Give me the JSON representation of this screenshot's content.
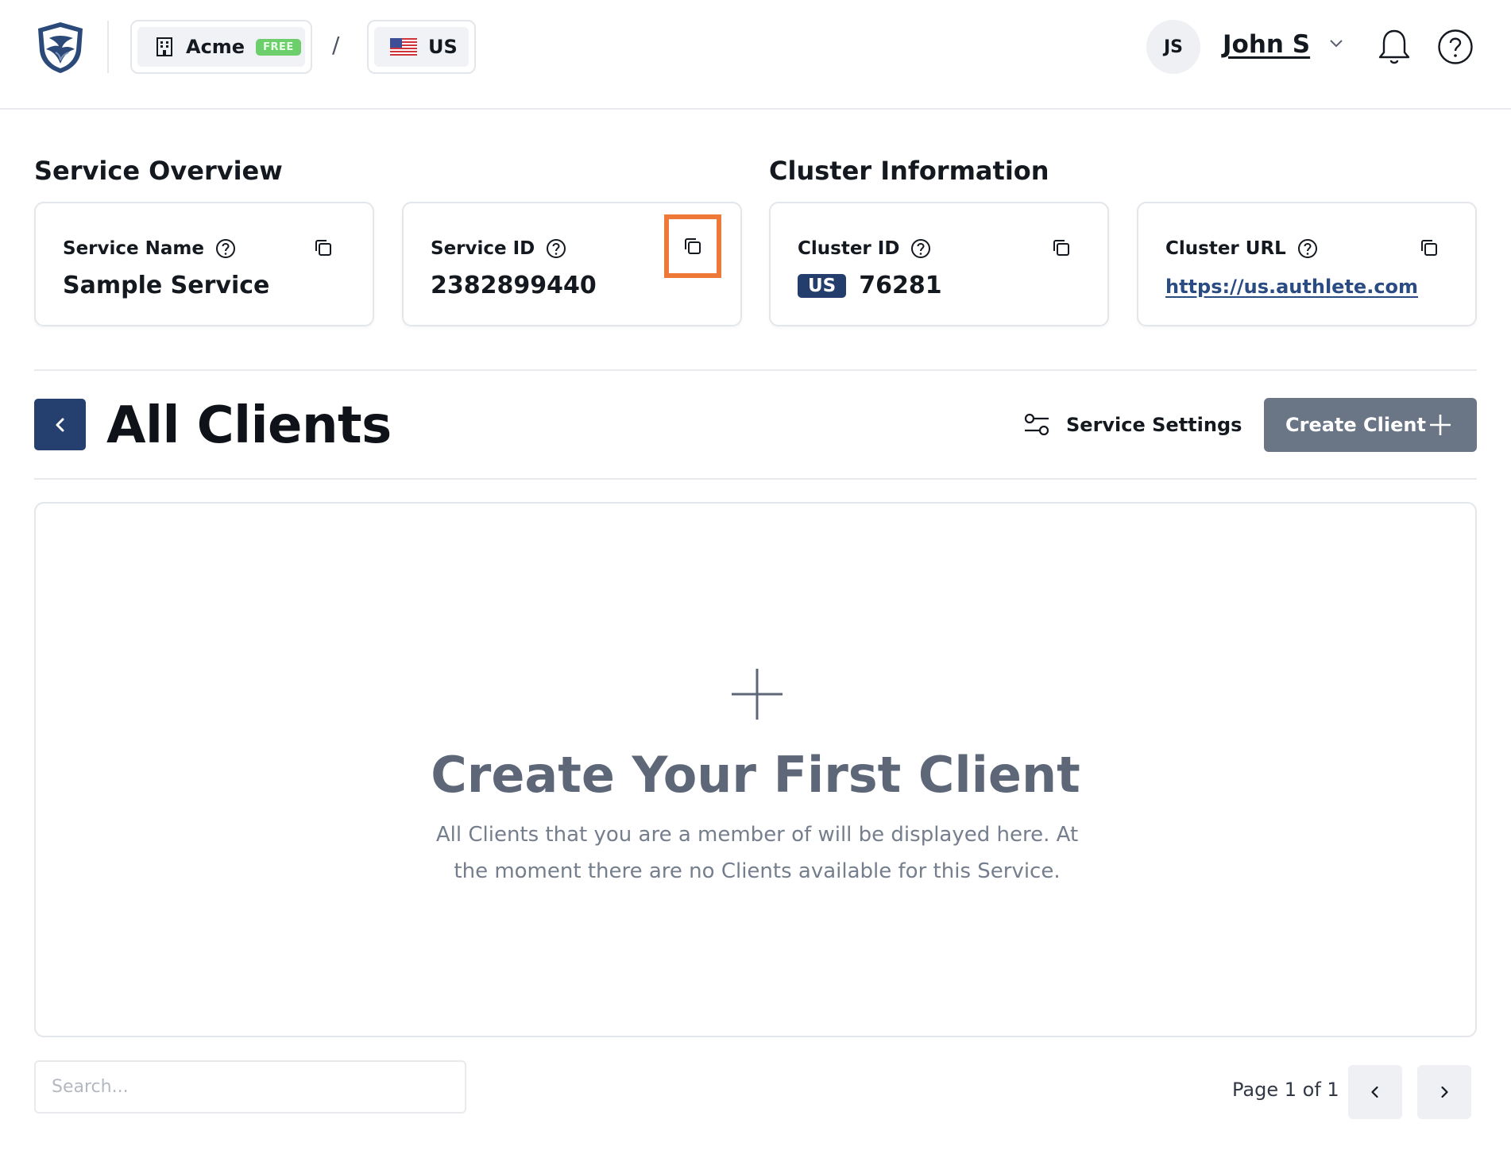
{
  "header": {
    "org": {
      "name": "Acme",
      "plan_badge": "FREE"
    },
    "separator": "/",
    "region": {
      "code": "US"
    },
    "user": {
      "initials": "JS",
      "name": "John S"
    }
  },
  "overview": {
    "service_title": "Service Overview",
    "cluster_title": "Cluster Information",
    "cards": {
      "service_name": {
        "label": "Service Name",
        "value": "Sample Service"
      },
      "service_id": {
        "label": "Service ID",
        "value": "2382899440"
      },
      "cluster_id": {
        "label": "Cluster ID",
        "region_tag": "US",
        "value": "76281"
      },
      "cluster_url": {
        "label": "Cluster URL",
        "value": "https://us.authlete.com"
      }
    }
  },
  "clients": {
    "title": "All Clients",
    "settings_label": "Service Settings",
    "create_label": "Create Client"
  },
  "empty_state": {
    "title": "Create Your First Client",
    "description": "All Clients that you are a member of will be displayed here. At the moment there are no Clients available for this Service."
  },
  "footer": {
    "search_placeholder": "Search...",
    "page_label": "Page 1 of 1"
  },
  "colors": {
    "primary_navy": "#253f6e",
    "create_button": "#6a7586",
    "free_badge": "#6ccf6b",
    "highlight_outline": "#ee7838",
    "link": "#2a4c83"
  },
  "icons": [
    "shield-logo-icon",
    "building-icon",
    "us-flag-icon",
    "chevron-down-icon",
    "bell-icon",
    "help-icon",
    "question-icon",
    "copy-icon",
    "chevron-left-icon",
    "sliders-icon",
    "plus-icon",
    "chevron-right-icon"
  ]
}
